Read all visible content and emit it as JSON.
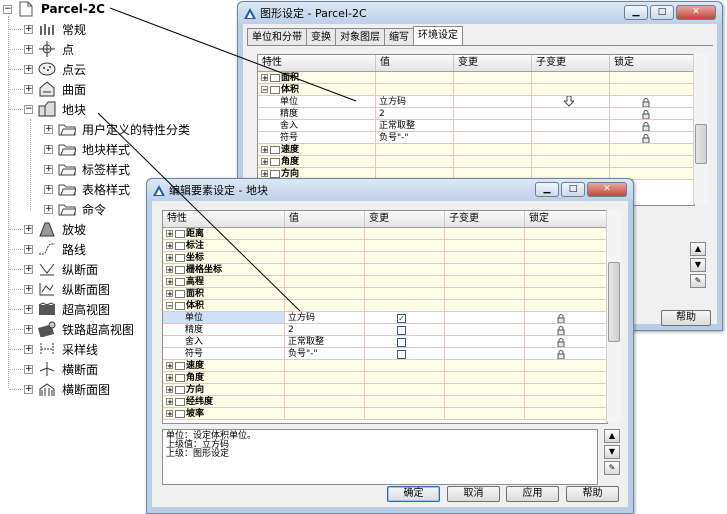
{
  "tree": {
    "root": "Parcel-2C",
    "items": [
      "常规",
      "点",
      "点云",
      "曲面",
      "地块",
      "放坡",
      "路线",
      "纵断面",
      "纵断面图",
      "超高视图",
      "铁路超高视图",
      "采样线",
      "横断面",
      "横断面图"
    ],
    "parcel_children": [
      "用户定义的特性分类",
      "地块样式",
      "标签样式",
      "表格样式",
      "命令"
    ]
  },
  "back_window": {
    "title": "图形设定 - Parcel-2C",
    "tabs": [
      "单位和分带",
      "变换",
      "对象图层",
      "缩写",
      "环境设定"
    ],
    "columns": [
      "特性",
      "值",
      "变更",
      "子变更",
      "锁定"
    ],
    "rows": [
      {
        "name": "面积",
        "bold": true,
        "exp": "+",
        "value": ""
      },
      {
        "name": "体积",
        "bold": true,
        "exp": "-",
        "value": ""
      },
      {
        "name": "单位",
        "value": "立方码",
        "child": true
      },
      {
        "name": "精度",
        "value": "2",
        "child": true
      },
      {
        "name": "舍入",
        "value": "正常取整",
        "child": true
      },
      {
        "name": "符号",
        "value": "负号\"-\"",
        "child": true
      },
      {
        "name": "速度",
        "bold": true,
        "exp": "+",
        "value": ""
      },
      {
        "name": "角度",
        "bold": true,
        "exp": "+",
        "value": ""
      },
      {
        "name": "方向",
        "bold": true,
        "exp": "+",
        "value": ""
      }
    ],
    "help_label": "帮助"
  },
  "front_window": {
    "title": "编辑要素设定 - 地块",
    "columns": [
      "特性",
      "值",
      "变更",
      "子变更",
      "锁定"
    ],
    "rows": [
      {
        "name": "距离",
        "bold": true,
        "exp": "+",
        "value": ""
      },
      {
        "name": "标注",
        "bold": true,
        "exp": "+",
        "value": ""
      },
      {
        "name": "坐标",
        "bold": true,
        "exp": "+",
        "value": ""
      },
      {
        "name": "栅格坐标",
        "bold": true,
        "exp": "+",
        "value": ""
      },
      {
        "name": "高程",
        "bold": true,
        "exp": "+",
        "value": ""
      },
      {
        "name": "面积",
        "bold": true,
        "exp": "+",
        "value": ""
      },
      {
        "name": "体积",
        "bold": true,
        "exp": "-",
        "value": ""
      },
      {
        "name": "单位",
        "value": "立方码",
        "child": true,
        "checked": true,
        "selected": true
      },
      {
        "name": "精度",
        "value": "2",
        "child": true,
        "checked": false
      },
      {
        "name": "舍入",
        "value": "正常取整",
        "child": true,
        "checked": false
      },
      {
        "name": "符号",
        "value": "负号\"-\"",
        "child": true,
        "checked": false
      },
      {
        "name": "速度",
        "bold": true,
        "exp": "+",
        "value": ""
      },
      {
        "name": "角度",
        "bold": true,
        "exp": "+",
        "value": ""
      },
      {
        "name": "方向",
        "bold": true,
        "exp": "+",
        "value": ""
      },
      {
        "name": "经纬度",
        "bold": true,
        "exp": "+",
        "value": ""
      },
      {
        "name": "坡率",
        "bold": true,
        "exp": "+",
        "value": ""
      }
    ],
    "description": [
      "单位：设定体积单位。",
      "上级值：立方码",
      "上级：图形设定"
    ],
    "buttons": {
      "ok": "确定",
      "cancel": "取消",
      "apply": "应用",
      "help": "帮助"
    }
  }
}
